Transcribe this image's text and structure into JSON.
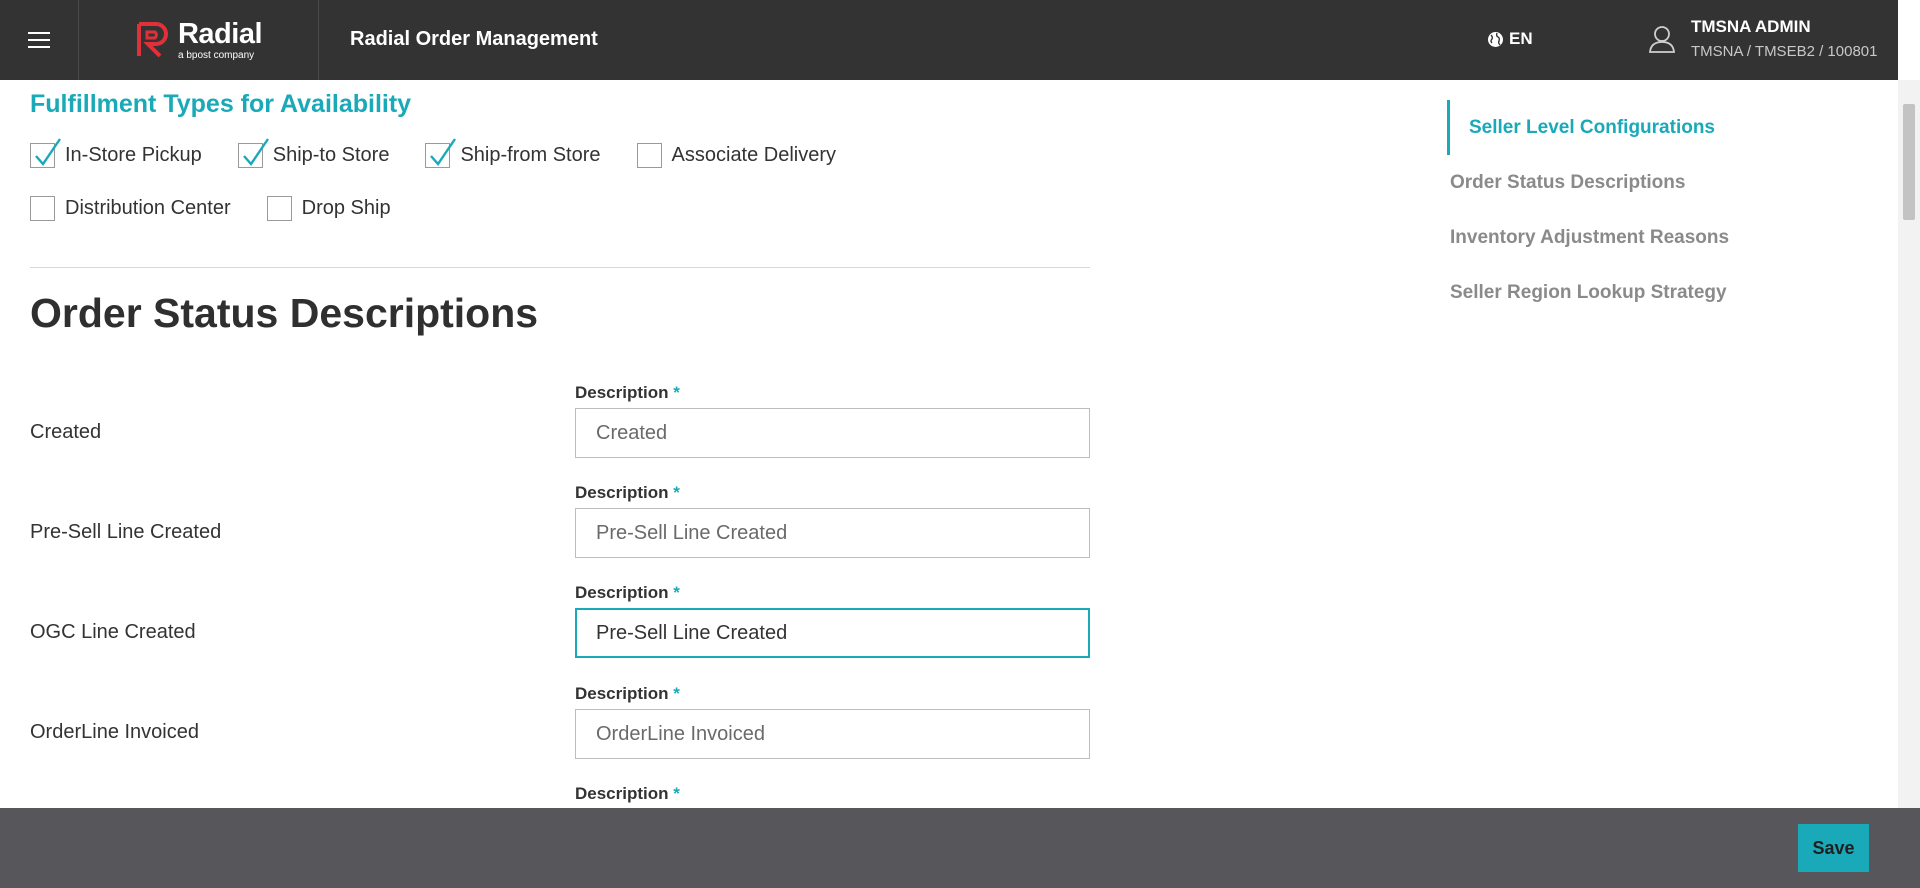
{
  "header": {
    "menu_icon": "hamburger-icon",
    "logo_name": "Radial",
    "logo_tagline": "a bpost company",
    "app_title": "Radial Order Management",
    "language": "EN",
    "language_icon": "globe-icon",
    "user_icon": "user-icon",
    "user_name": "TMSNA ADMIN",
    "user_org": "TMSNA / TMSEB2 / 100801"
  },
  "fulfillment": {
    "heading": "Fulfillment Types for Availability",
    "options": [
      {
        "label": "In-Store Pickup",
        "checked": true
      },
      {
        "label": "Ship-to Store",
        "checked": true
      },
      {
        "label": "Ship-from Store",
        "checked": true
      },
      {
        "label": "Associate Delivery",
        "checked": false
      },
      {
        "label": "Distribution Center",
        "checked": false
      },
      {
        "label": "Drop Ship",
        "checked": false
      }
    ]
  },
  "order_status": {
    "title": "Order Status Descriptions",
    "field_label": "Description",
    "required_mark": "*",
    "rows": [
      {
        "status": "Created",
        "value": "Created"
      },
      {
        "status": "Pre-Sell Line Created",
        "value": "Pre-Sell Line Created"
      },
      {
        "status": "OGC Line Created",
        "value": "Pre-Sell Line Created"
      },
      {
        "status": "OrderLine Invoiced",
        "value": "OrderLine Invoiced"
      }
    ]
  },
  "side_nav": {
    "items": [
      {
        "label": "Seller Level Configurations",
        "active": true
      },
      {
        "label": "Order Status Descriptions",
        "active": false
      },
      {
        "label": "Inventory Adjustment Reasons",
        "active": false
      },
      {
        "label": "Seller Region Lookup Strategy",
        "active": false
      }
    ]
  },
  "footer": {
    "save_label": "Save"
  },
  "colors": {
    "accent": "#19a9b8",
    "header_bg": "#333333",
    "footer_bg": "#57575b",
    "logo_red": "#e0303a"
  }
}
